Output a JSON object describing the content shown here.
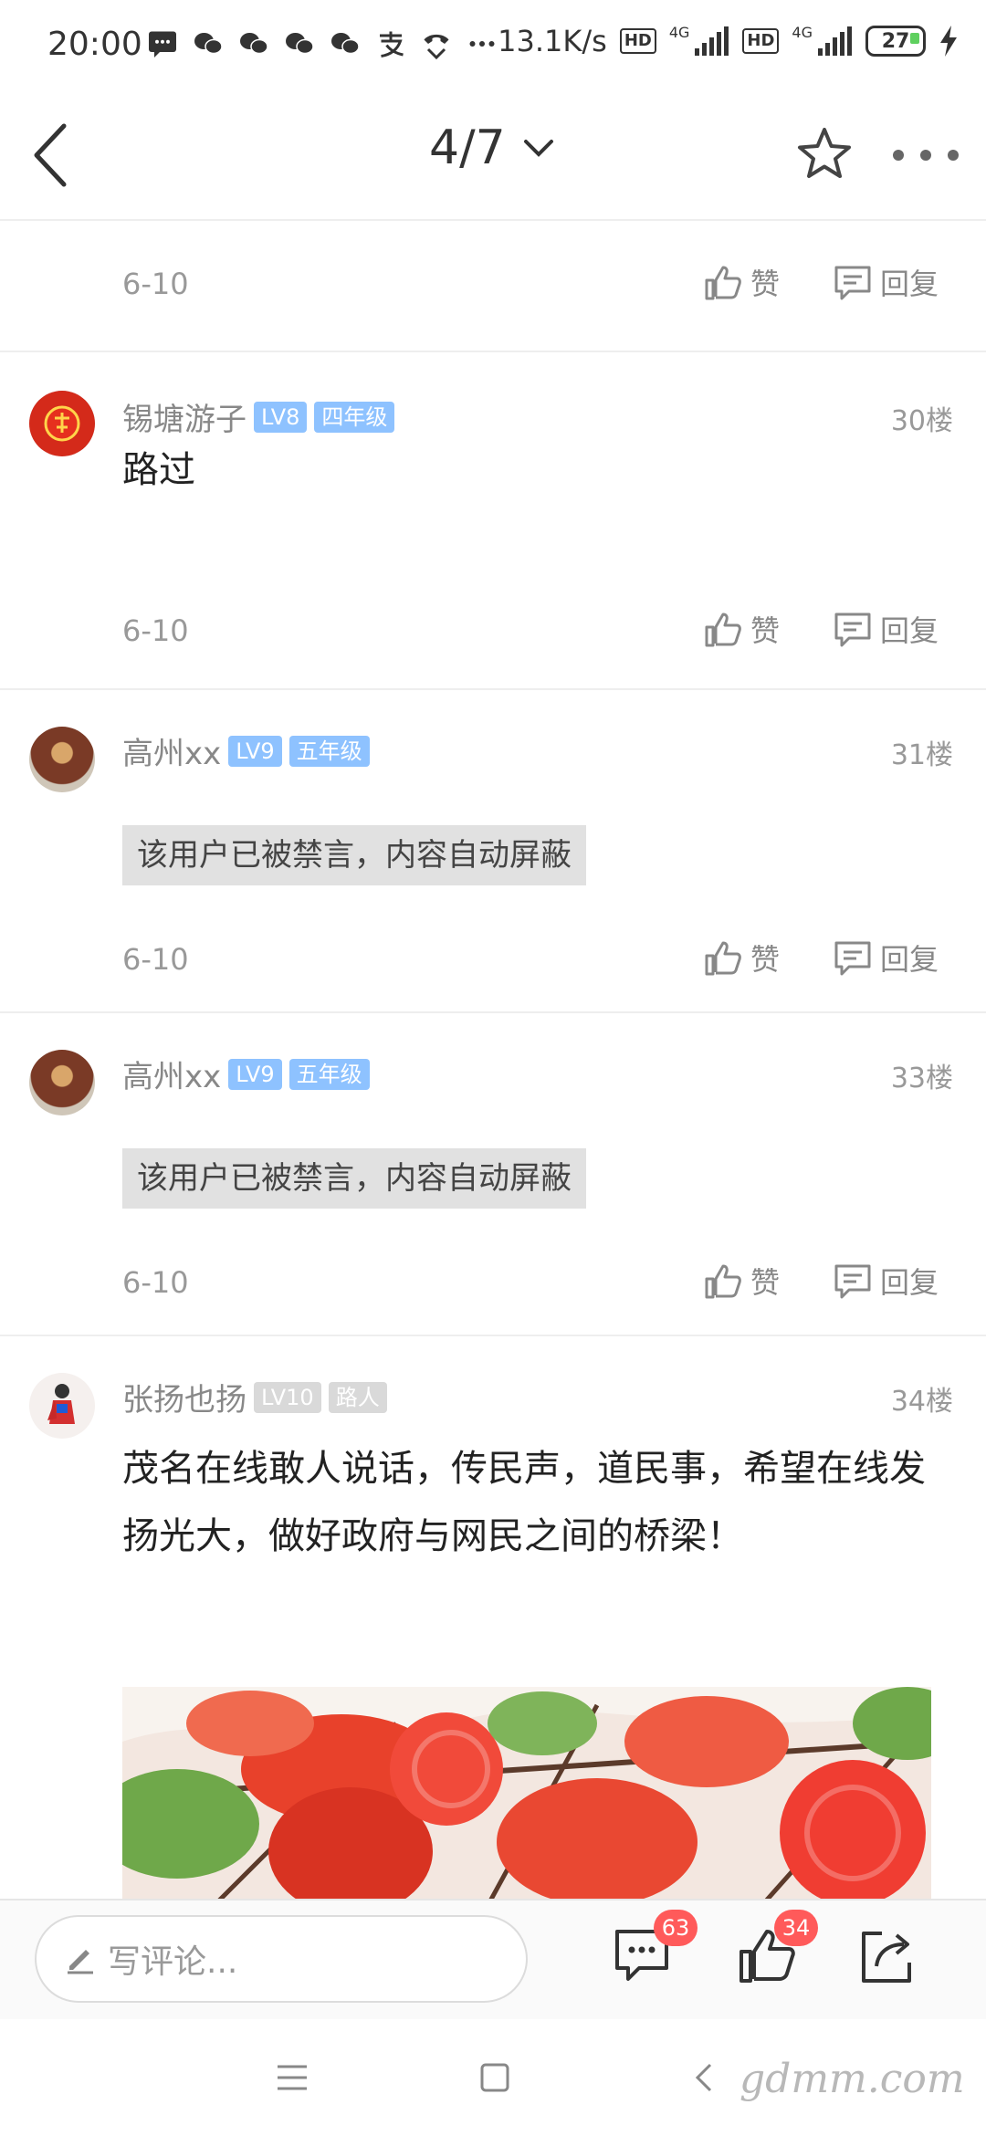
{
  "status_bar": {
    "time": "20:00",
    "net_speed": "13.1K/s",
    "hd1": "HD",
    "hd2": "HD",
    "signal1_label": "4G",
    "signal2_label": "4G",
    "battery": "27",
    "icons": [
      "message-icon",
      "wechat-icon",
      "wechat-icon",
      "wechat-icon",
      "wechat-icon",
      "alipay-icon",
      "phone-icon",
      "more-dots-icon"
    ]
  },
  "top_bar": {
    "page_indicator": "4/7"
  },
  "actions": {
    "like_label": "赞",
    "reply_label": "回复"
  },
  "posts": [
    {
      "date": "6-10"
    },
    {
      "username": "锡塘游子",
      "level": "LV8",
      "grade": "四年级",
      "floor": "30楼",
      "text": "路过",
      "date": "6-10"
    },
    {
      "username": "高州xx",
      "level": "LV9",
      "grade": "五年级",
      "floor": "31楼",
      "muted_text": "该用户已被禁言，内容自动屏蔽",
      "date": "6-10"
    },
    {
      "username": "高州xx",
      "level": "LV9",
      "grade": "五年级",
      "floor": "33楼",
      "muted_text": "该用户已被禁言，内容自动屏蔽",
      "date": "6-10"
    },
    {
      "username": "张扬也扬",
      "level": "LV10",
      "grade": "路人",
      "floor": "34楼",
      "text": "茂名在线敢人说话，传民声，道民事，希望在线发扬光大，做好政府与网民之间的桥梁！"
    }
  ],
  "bottom_bar": {
    "comment_placeholder": "写评论...",
    "comment_count": "63",
    "like_count": "34"
  },
  "watermark": "gdmm.com",
  "colors": {
    "badge_blue": "#8ec2ff",
    "badge_grey": "#d9d9d9",
    "count_badge": "#ff5a5a"
  }
}
